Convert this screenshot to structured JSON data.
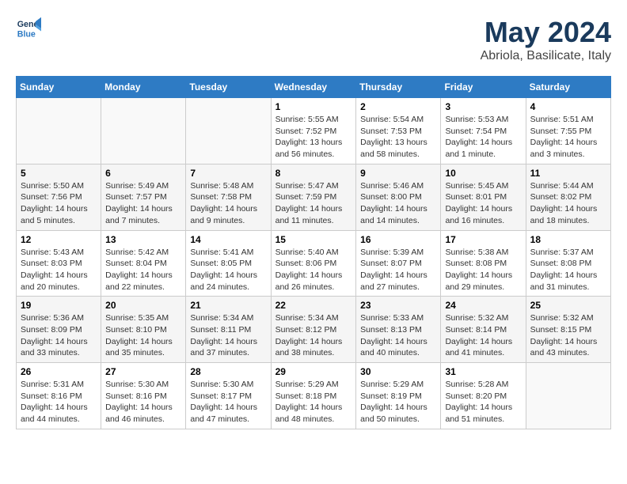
{
  "header": {
    "logo_line1": "General",
    "logo_line2": "Blue",
    "month": "May 2024",
    "location": "Abriola, Basilicate, Italy"
  },
  "days_of_week": [
    "Sunday",
    "Monday",
    "Tuesday",
    "Wednesday",
    "Thursday",
    "Friday",
    "Saturday"
  ],
  "weeks": [
    {
      "days": [
        {
          "num": "",
          "info": ""
        },
        {
          "num": "",
          "info": ""
        },
        {
          "num": "",
          "info": ""
        },
        {
          "num": "1",
          "info": "Sunrise: 5:55 AM\nSunset: 7:52 PM\nDaylight: 13 hours\nand 56 minutes."
        },
        {
          "num": "2",
          "info": "Sunrise: 5:54 AM\nSunset: 7:53 PM\nDaylight: 13 hours\nand 58 minutes."
        },
        {
          "num": "3",
          "info": "Sunrise: 5:53 AM\nSunset: 7:54 PM\nDaylight: 14 hours\nand 1 minute."
        },
        {
          "num": "4",
          "info": "Sunrise: 5:51 AM\nSunset: 7:55 PM\nDaylight: 14 hours\nand 3 minutes."
        }
      ]
    },
    {
      "days": [
        {
          "num": "5",
          "info": "Sunrise: 5:50 AM\nSunset: 7:56 PM\nDaylight: 14 hours\nand 5 minutes."
        },
        {
          "num": "6",
          "info": "Sunrise: 5:49 AM\nSunset: 7:57 PM\nDaylight: 14 hours\nand 7 minutes."
        },
        {
          "num": "7",
          "info": "Sunrise: 5:48 AM\nSunset: 7:58 PM\nDaylight: 14 hours\nand 9 minutes."
        },
        {
          "num": "8",
          "info": "Sunrise: 5:47 AM\nSunset: 7:59 PM\nDaylight: 14 hours\nand 11 minutes."
        },
        {
          "num": "9",
          "info": "Sunrise: 5:46 AM\nSunset: 8:00 PM\nDaylight: 14 hours\nand 14 minutes."
        },
        {
          "num": "10",
          "info": "Sunrise: 5:45 AM\nSunset: 8:01 PM\nDaylight: 14 hours\nand 16 minutes."
        },
        {
          "num": "11",
          "info": "Sunrise: 5:44 AM\nSunset: 8:02 PM\nDaylight: 14 hours\nand 18 minutes."
        }
      ]
    },
    {
      "days": [
        {
          "num": "12",
          "info": "Sunrise: 5:43 AM\nSunset: 8:03 PM\nDaylight: 14 hours\nand 20 minutes."
        },
        {
          "num": "13",
          "info": "Sunrise: 5:42 AM\nSunset: 8:04 PM\nDaylight: 14 hours\nand 22 minutes."
        },
        {
          "num": "14",
          "info": "Sunrise: 5:41 AM\nSunset: 8:05 PM\nDaylight: 14 hours\nand 24 minutes."
        },
        {
          "num": "15",
          "info": "Sunrise: 5:40 AM\nSunset: 8:06 PM\nDaylight: 14 hours\nand 26 minutes."
        },
        {
          "num": "16",
          "info": "Sunrise: 5:39 AM\nSunset: 8:07 PM\nDaylight: 14 hours\nand 27 minutes."
        },
        {
          "num": "17",
          "info": "Sunrise: 5:38 AM\nSunset: 8:08 PM\nDaylight: 14 hours\nand 29 minutes."
        },
        {
          "num": "18",
          "info": "Sunrise: 5:37 AM\nSunset: 8:08 PM\nDaylight: 14 hours\nand 31 minutes."
        }
      ]
    },
    {
      "days": [
        {
          "num": "19",
          "info": "Sunrise: 5:36 AM\nSunset: 8:09 PM\nDaylight: 14 hours\nand 33 minutes."
        },
        {
          "num": "20",
          "info": "Sunrise: 5:35 AM\nSunset: 8:10 PM\nDaylight: 14 hours\nand 35 minutes."
        },
        {
          "num": "21",
          "info": "Sunrise: 5:34 AM\nSunset: 8:11 PM\nDaylight: 14 hours\nand 37 minutes."
        },
        {
          "num": "22",
          "info": "Sunrise: 5:34 AM\nSunset: 8:12 PM\nDaylight: 14 hours\nand 38 minutes."
        },
        {
          "num": "23",
          "info": "Sunrise: 5:33 AM\nSunset: 8:13 PM\nDaylight: 14 hours\nand 40 minutes."
        },
        {
          "num": "24",
          "info": "Sunrise: 5:32 AM\nSunset: 8:14 PM\nDaylight: 14 hours\nand 41 minutes."
        },
        {
          "num": "25",
          "info": "Sunrise: 5:32 AM\nSunset: 8:15 PM\nDaylight: 14 hours\nand 43 minutes."
        }
      ]
    },
    {
      "days": [
        {
          "num": "26",
          "info": "Sunrise: 5:31 AM\nSunset: 8:16 PM\nDaylight: 14 hours\nand 44 minutes."
        },
        {
          "num": "27",
          "info": "Sunrise: 5:30 AM\nSunset: 8:16 PM\nDaylight: 14 hours\nand 46 minutes."
        },
        {
          "num": "28",
          "info": "Sunrise: 5:30 AM\nSunset: 8:17 PM\nDaylight: 14 hours\nand 47 minutes."
        },
        {
          "num": "29",
          "info": "Sunrise: 5:29 AM\nSunset: 8:18 PM\nDaylight: 14 hours\nand 48 minutes."
        },
        {
          "num": "30",
          "info": "Sunrise: 5:29 AM\nSunset: 8:19 PM\nDaylight: 14 hours\nand 50 minutes."
        },
        {
          "num": "31",
          "info": "Sunrise: 5:28 AM\nSunset: 8:20 PM\nDaylight: 14 hours\nand 51 minutes."
        },
        {
          "num": "",
          "info": ""
        }
      ]
    }
  ]
}
